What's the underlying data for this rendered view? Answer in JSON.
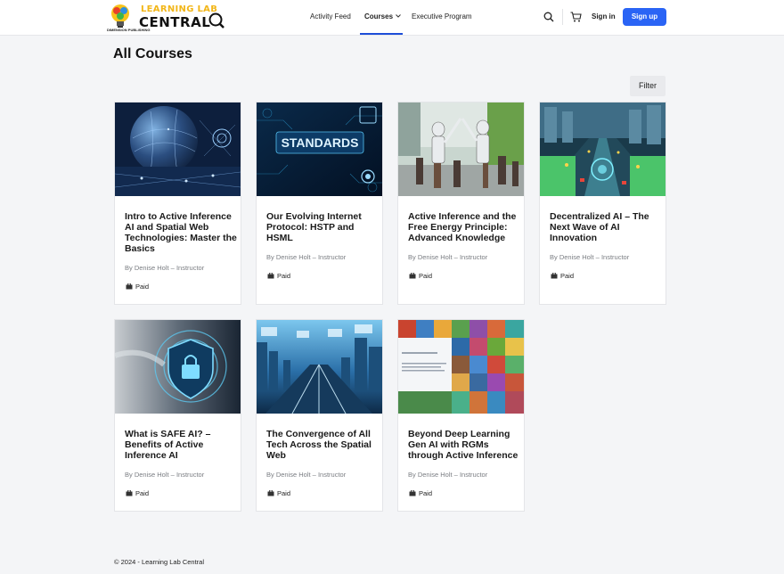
{
  "header": {
    "logo_line1": "LEARNING LAB",
    "logo_line2": "CENTRAL",
    "logo_sub": "DIMENSION PUBLISHING",
    "nav": [
      {
        "label": "Activity Feed"
      },
      {
        "label": "Courses"
      },
      {
        "label": "Executive Program"
      }
    ],
    "sign_in": "Sign in",
    "sign_up": "Sign up"
  },
  "main": {
    "title": "All Courses",
    "filter_label": "Filter",
    "courses": [
      {
        "title": " Intro to Active Inference AI and Spatial Web Technologies: Master the Basics",
        "author": "By Denise Holt – Instructor",
        "price": "Paid"
      },
      {
        "title": "Our Evolving Internet Protocol: HSTP and HSML",
        "author": "By Denise Holt – Instructor",
        "price": "Paid",
        "image_text": "STANDARDS"
      },
      {
        "title": "Active Inference and the Free Energy Principle: Advanced Knowledge",
        "author": "By Denise Holt – Instructor",
        "price": "Paid"
      },
      {
        "title": "Decentralized AI – The Next Wave of AI Innovation",
        "author": "By Denise Holt – Instructor",
        "price": "Paid"
      },
      {
        "title": "What is SAFE AI? – Benefits of Active Inference AI",
        "author": "By Denise Holt – Instructor",
        "price": "Paid"
      },
      {
        "title": "The Convergence of All Tech Across the Spatial Web",
        "author": "By Denise Holt – Instructor",
        "price": "Paid"
      },
      {
        "title": "Beyond Deep Learning Gen AI with RGMs through Active Inference",
        "author": "By Denise Holt – Instructor",
        "price": "Paid"
      }
    ]
  },
  "footer": {
    "text": "© 2024 - Learning Lab Central"
  },
  "colors": {
    "accent": "#2a64f5",
    "nav_underline": "#1d4ed8",
    "background": "#f4f5f7"
  },
  "icons": [
    "search-icon",
    "cart-icon",
    "chevron-down-icon",
    "price-tag-icon"
  ]
}
